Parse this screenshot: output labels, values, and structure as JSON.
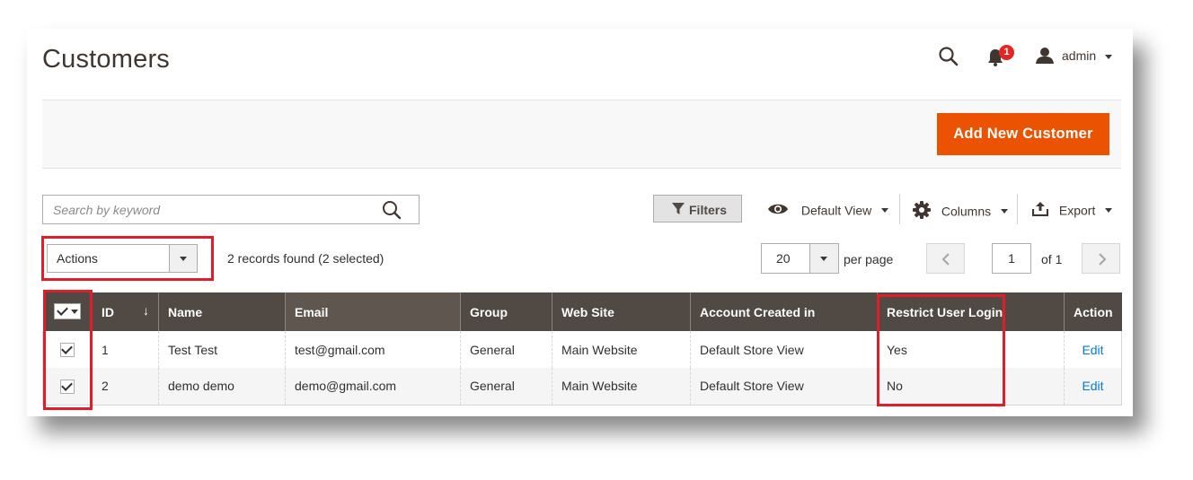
{
  "header": {
    "title": "Customers",
    "notifications_count": "1",
    "user_name": "admin"
  },
  "page_actions": {
    "add_label": "Add New Customer"
  },
  "toolbar": {
    "search_placeholder": "Search by keyword",
    "filters_label": "Filters",
    "view_label": "Default View",
    "columns_label": "Columns",
    "export_label": "Export"
  },
  "mass_actions": {
    "label": "Actions",
    "records_text": "2 records found (2 selected)"
  },
  "pager": {
    "per_page_value": "20",
    "per_page_label": "per page",
    "current_page": "1",
    "of_label": "of 1"
  },
  "grid": {
    "columns": [
      "ID",
      "Name",
      "Email",
      "Group",
      "Web Site",
      "Account Created in",
      "Restrict User Login",
      "Action"
    ],
    "rows": [
      {
        "id": "1",
        "name": "Test Test",
        "email": "test@gmail.com",
        "group": "General",
        "website": "Main Website",
        "created_in": "Default Store View",
        "restrict": "Yes",
        "action": "Edit"
      },
      {
        "id": "2",
        "name": "demo demo",
        "email": "demo@gmail.com",
        "group": "General",
        "website": "Main Website",
        "created_in": "Default Store View",
        "restrict": "No",
        "action": "Edit"
      }
    ]
  },
  "colors": {
    "accent": "#eb5202",
    "header_bg": "#514943",
    "highlight": "#e11d2a",
    "link": "#007bdb"
  }
}
